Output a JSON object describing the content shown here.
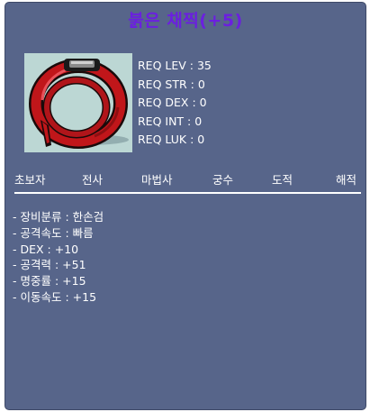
{
  "item": {
    "name": "붉은 채찍(+5)",
    "title_color": "#6b1fe0",
    "icon": "red-whip-icon"
  },
  "requirements": [
    {
      "label": "REQ LEV",
      "value": "35"
    },
    {
      "label": "REQ STR",
      "value": "0"
    },
    {
      "label": "REQ DEX",
      "value": "0"
    },
    {
      "label": "REQ INT",
      "value": "0"
    },
    {
      "label": "REQ LUK",
      "value": "0"
    }
  ],
  "jobs": [
    "초보자",
    "전사",
    "마법사",
    "궁수",
    "도적",
    "해적"
  ],
  "stats": [
    "- 장비분류 : 한손검",
    "- 공격속도 : 빠름",
    "- DEX : +10",
    "- 공격력 : +51",
    "- 명중률 : +15",
    "- 이동속도 : +15"
  ],
  "colors": {
    "panel_background": "#57658a",
    "text": "#ffffff"
  }
}
